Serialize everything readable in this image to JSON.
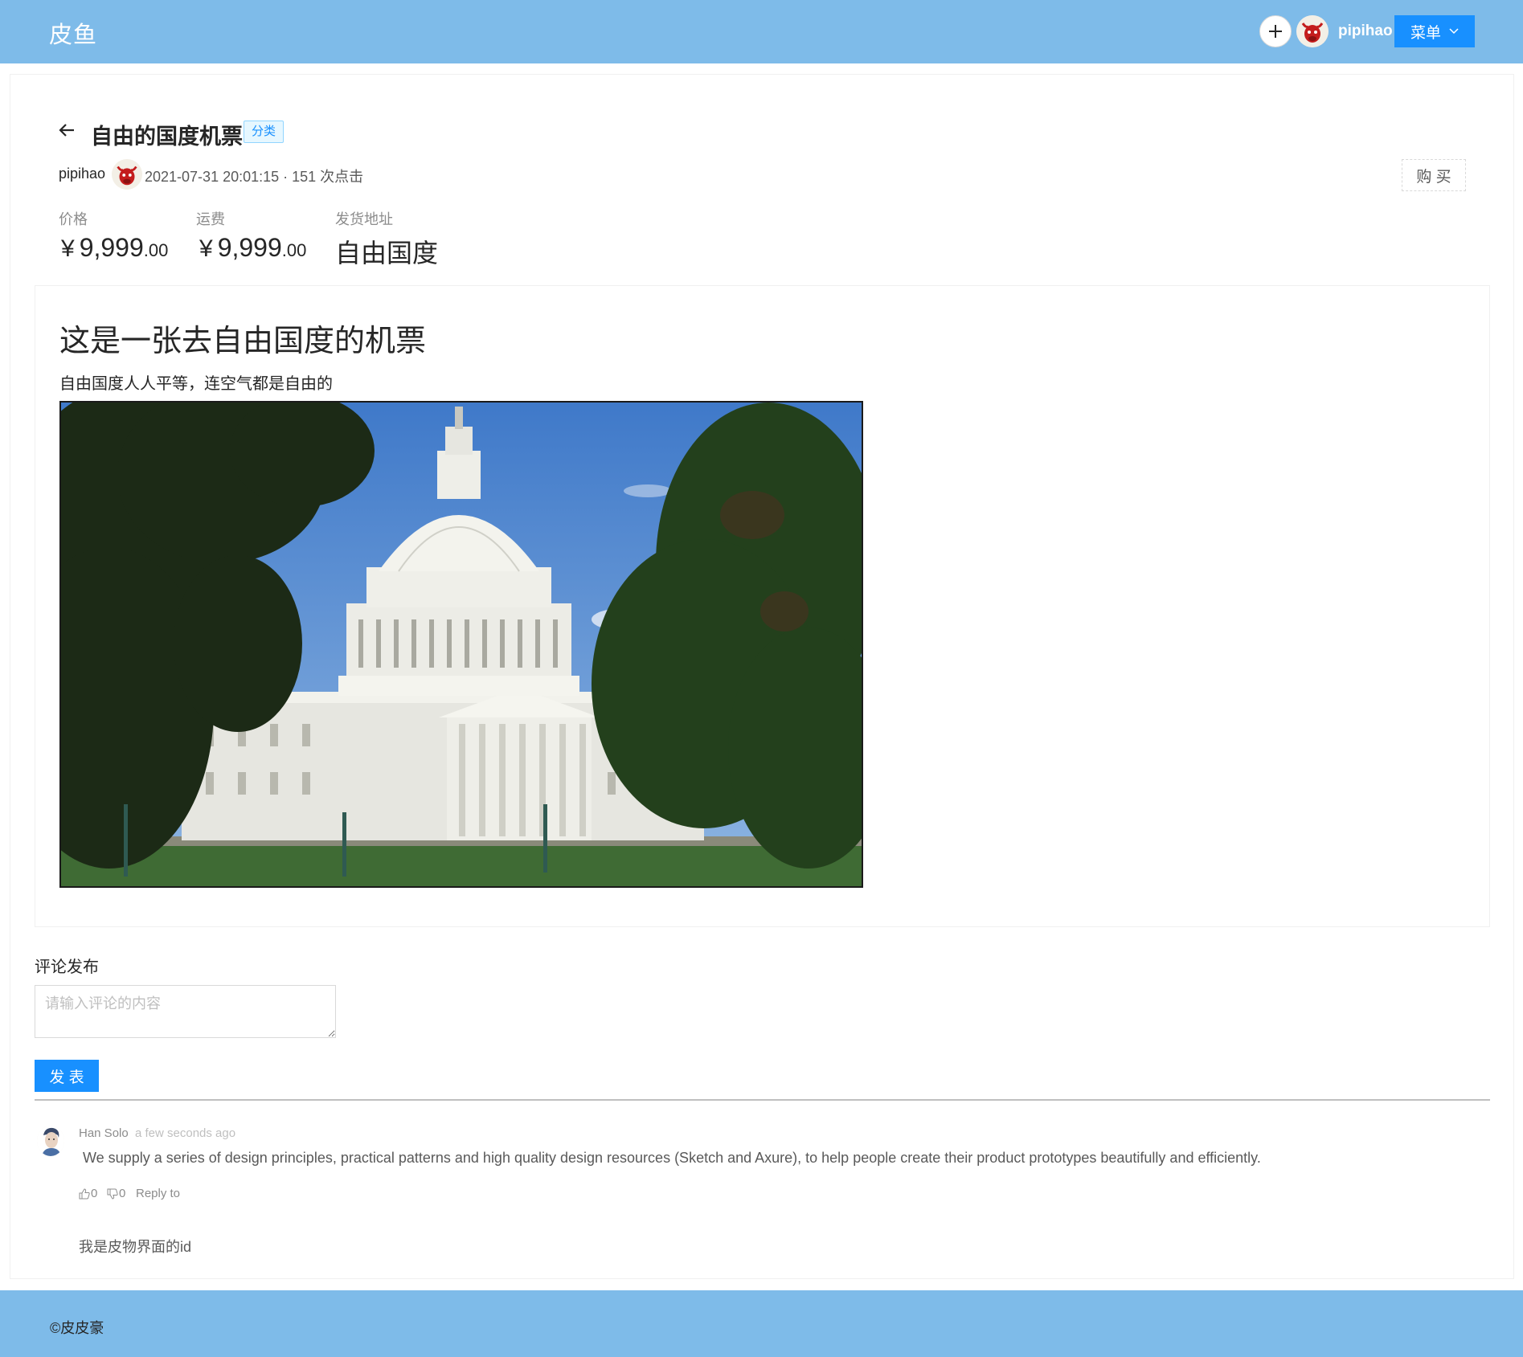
{
  "header": {
    "logo": "皮鱼",
    "username": "pipihao",
    "menu_label": "菜单",
    "icons": [
      "plus-icon",
      "avatar",
      "chevron-down-icon"
    ]
  },
  "item": {
    "title": "自由的国度机票",
    "tag": "分类",
    "author": "pipihao",
    "meta": "2021-07-31 20:01:15 · 151 次点击",
    "buy_label": "购 买",
    "stats": [
      {
        "label": "价格",
        "currency": "¥",
        "integer": "9,999",
        "decimal": ".00"
      },
      {
        "label": "运费",
        "currency": "¥",
        "integer": "9,999",
        "decimal": ".00"
      },
      {
        "label": "发货地址",
        "value": "自由国度"
      }
    ]
  },
  "content": {
    "heading": "这是一张去自由国度的机票",
    "text": "自由国度人人平等，连空气都是自由的"
  },
  "comment_form": {
    "label": "评论发布",
    "placeholder": "请输入评论的内容",
    "submit_label": "发 表"
  },
  "comments": [
    {
      "author": "Han Solo",
      "time": "a few seconds ago",
      "text": "We supply a series of design principles, practical patterns and high quality design resources (Sketch and Axure), to help people create their product prototypes beautifully and efficiently.",
      "likes": "0",
      "dislikes": "0",
      "reply_label": "Reply to",
      "child_text": "我是皮物界面的id"
    }
  ],
  "footer": {
    "text": "©皮皮豪"
  },
  "colors": {
    "header_bg": "#7ebbe9",
    "primary": "#1890ff",
    "tag_bg": "#e6f7ff",
    "footer_bg": "#7ebbe9"
  }
}
